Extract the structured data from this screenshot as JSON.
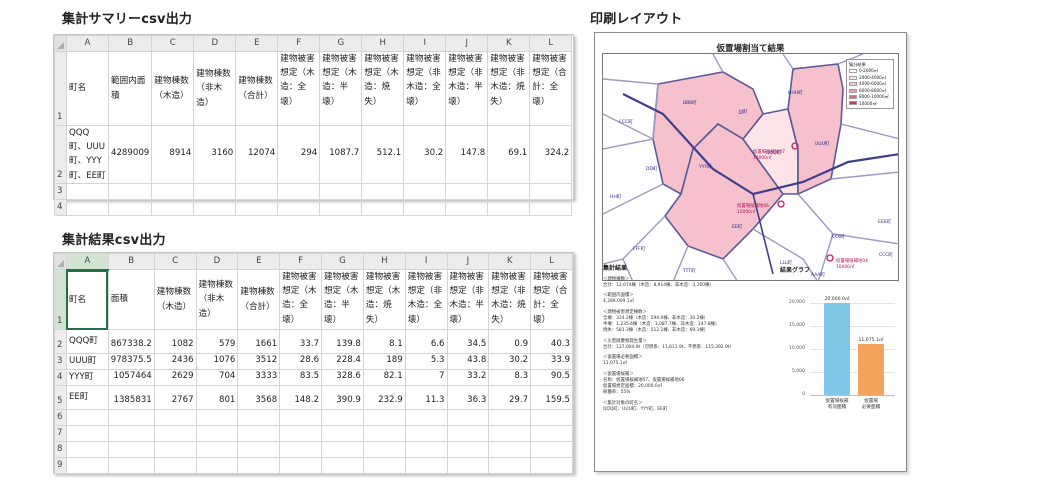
{
  "summary_sheet": {
    "title": "集計サマリーcsv出力",
    "columns": [
      "A",
      "B",
      "C",
      "D",
      "E",
      "F",
      "G",
      "H",
      "I",
      "J",
      "K",
      "L"
    ],
    "row_numbers": [
      "1",
      "2",
      "3",
      "4"
    ],
    "header_row": [
      "町名",
      "範囲内面積",
      "建物棟数（木造）",
      "建物棟数（非木造）",
      "建物棟数（合計）",
      "建物被害想定（木造：全壊）",
      "建物被害想定（木造：半壊）",
      "建物被害想定（木造：焼失）",
      "建物被害想定（非木造：全壊）",
      "建物被害想定（非木造：半壊）",
      "建物被害想定（非木造：焼失）",
      "建物被害想定（合計：全壊）"
    ],
    "data_rows": [
      [
        "QQQ町、UUU町、YYY町、EE町",
        "4289009",
        "8914",
        "3160",
        "12074",
        "294",
        "1087.7",
        "512.1",
        "30.2",
        "147.8",
        "69.1",
        "324.2"
      ]
    ],
    "empty_rows": [
      "3",
      "4"
    ]
  },
  "result_sheet": {
    "title": "集計結果csv出力",
    "columns": [
      "A",
      "B",
      "C",
      "D",
      "E",
      "F",
      "G",
      "H",
      "I",
      "J",
      "K",
      "L"
    ],
    "row_numbers": [
      "1",
      "2",
      "3",
      "4",
      "5",
      "6",
      "7",
      "8",
      "9"
    ],
    "header_row": [
      "町名",
      "面積",
      "建物棟数（木造）",
      "建物棟数（非木造）",
      "建物棟数（合計）",
      "建物被害想定（木造：全壊）",
      "建物被害想定（木造：半壊）",
      "建物被害想定（木造：焼失）",
      "建物被害想定（非木造：全壊）",
      "建物被害想定（非木造：半壊）",
      "建物被害想定（非木造：焼失）",
      "建物被害想定（合計：全壊）"
    ],
    "data_rows": [
      [
        "QQQ町",
        "867338.2",
        "1082",
        "579",
        "1661",
        "33.7",
        "139.8",
        "8.1",
        "6.6",
        "34.5",
        "0.9",
        "40.3"
      ],
      [
        "UUU町",
        "978375.5",
        "2436",
        "1076",
        "3512",
        "28.6",
        "228.4",
        "189",
        "5.3",
        "43.8",
        "30.2",
        "33.9"
      ],
      [
        "YYY町",
        "1057464",
        "2629",
        "704",
        "3333",
        "83.5",
        "328.6",
        "82.1",
        "7",
        "33.2",
        "8.3",
        "90.5"
      ],
      [
        "EE町",
        "1385831",
        "2767",
        "801",
        "3568",
        "148.2",
        "390.9",
        "232.9",
        "11.3",
        "36.3",
        "29.7",
        "159.5"
      ]
    ],
    "empty_rows": [
      "6",
      "7",
      "8",
      "9"
    ]
  },
  "print_layout": {
    "title": "印刷レイアウト",
    "page_title": "仮置場割当て結果",
    "legend": {
      "title": "集計結果",
      "items": [
        {
          "label": "0-2000㎡",
          "color": "#ffffff"
        },
        {
          "label": "2000-4000㎡",
          "color": "#fce4e8"
        },
        {
          "label": "4000-6000㎡",
          "color": "#f6c0cc"
        },
        {
          "label": "6000-8000㎡",
          "color": "#ef99aa"
        },
        {
          "label": "8000-10000㎡",
          "color": "#e06680"
        },
        {
          "label": "10000㎡-",
          "color": "#c8385a"
        }
      ]
    },
    "map_labels": [
      "HHH町",
      "BBB町",
      "JJJ町",
      "CCC町",
      "UUU町",
      "QQQ町",
      "DD町",
      "YYY町",
      "HH町",
      "EE町",
      "EEE町",
      "XXX町",
      "FFF町",
      "CCC町",
      "TTT町",
      "LLL町",
      "AAA町"
    ],
    "candidates": [
      {
        "name": "仮置場候補地07",
        "area": "10000㎡"
      },
      {
        "name": "仮置場候補地06",
        "area": "10000㎡"
      },
      {
        "name": "仮置場候補地04",
        "area": "10000㎡"
      }
    ],
    "summary": {
      "title": "集計結果",
      "blocks": [
        [
          "＜建物棟数＞",
          "合計：12,074棟（木造：8,914棟、非木造：3,160棟）"
        ],
        [
          "＜範囲内面積＞",
          "4,289,009.1㎡"
        ],
        [
          "＜建物被害想定棟数＞",
          "全壊：324.2棟（木造：294.0棟、非木造：30.2棟）",
          "半壊：1,235.4棟（木造：1,087.7棟、非木造：147.8棟）",
          "焼失：581.3棟（木造：512.1棟、非木造：69.1棟）"
        ],
        [
          "＜災害廃棄物発生量＞",
          "合計：127,004.9t（可燃系：11,611.9t、不燃系：115,392.9t）"
        ],
        [
          "＜仮置場必要面積＞",
          "11,075.1㎡"
        ],
        [
          "＜仮置場候補＞",
          "名称：仮置場候補地07、仮置場候補地06",
          "仮置場想定面積：20,000.0㎡",
          "稼働率：55%"
        ],
        [
          "＜集計対象の町名＞",
          "QQQ町、UUU町、YYY町、EE町"
        ]
      ]
    },
    "graph": {
      "title": "結果グラフ",
      "ticks": [
        "20,000",
        "15,000",
        "10,000",
        "5,000",
        "0"
      ]
    }
  },
  "chart_data": {
    "type": "bar",
    "title": "結果グラフ",
    "categories": [
      "仮置場候補有効面積",
      "仮置場必要面積"
    ],
    "values": [
      20000.0,
      11075.1
    ],
    "value_labels": [
      "20,000.0㎡",
      "11,075.1㎡"
    ],
    "bar_colors": [
      "#7fc8e8",
      "#f4a35c"
    ],
    "ylim": [
      0,
      20000
    ],
    "grid": true
  }
}
